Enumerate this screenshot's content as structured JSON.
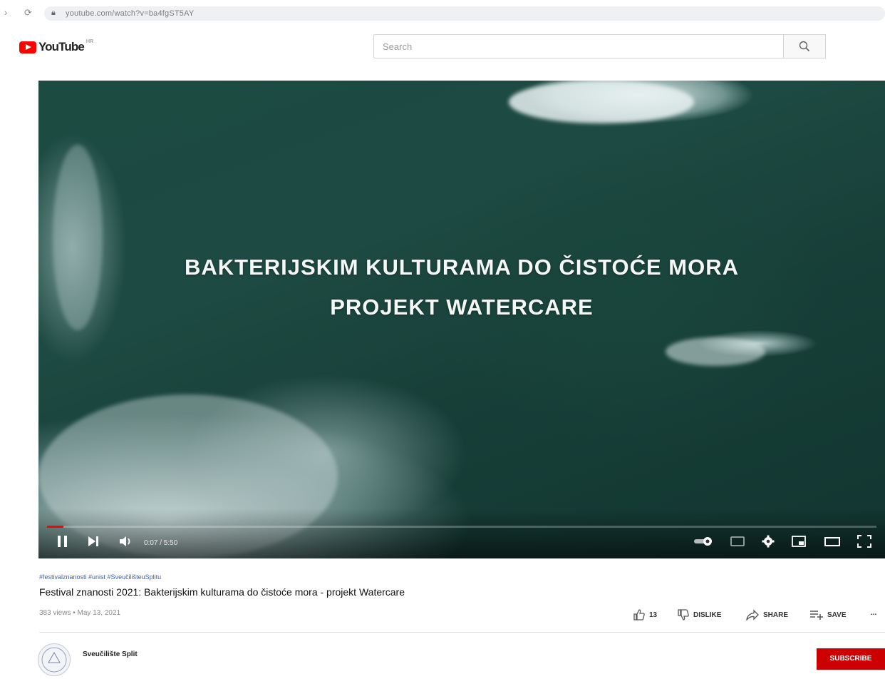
{
  "browser": {
    "url": "youtube.com/watch?v=ba4fgST5AY"
  },
  "masthead": {
    "logo_text": "YouTube",
    "logo_region": "HR",
    "search": {
      "placeholder": "Search",
      "icon": "search-icon"
    }
  },
  "player": {
    "overlay_line1": "BAKTERIJSKIM KULTURAMA DO ČISTOĆE MORA",
    "overlay_line2": "PROJEKT WATERCARE",
    "time": "0:07 / 5:50",
    "progress_fraction": 0.02,
    "accent_color": "#ff0000",
    "controls": [
      "pause-icon",
      "next-icon",
      "volume-icon",
      "autoplay-toggle",
      "subtitles-icon",
      "settings-icon",
      "miniplayer-icon",
      "theater-icon",
      "fullscreen-icon"
    ]
  },
  "video": {
    "hashtags": "#festivalznanosti #unist #SveučilišteuSplitu",
    "title": "Festival znanosti 2021: Bakterijskim kulturama do čistoće mora - projekt Watercare",
    "meta": "383 views • May 13, 2021",
    "actions": {
      "like_count": "13",
      "dislike_label": "DISLIKE",
      "share_label": "SHARE",
      "save_label": "SAVE",
      "more_label": "..."
    }
  },
  "channel": {
    "name": "Sveučilište Split",
    "subscribe_label": "SUBSCRIBE",
    "subscribe_color": "#cc0000"
  }
}
